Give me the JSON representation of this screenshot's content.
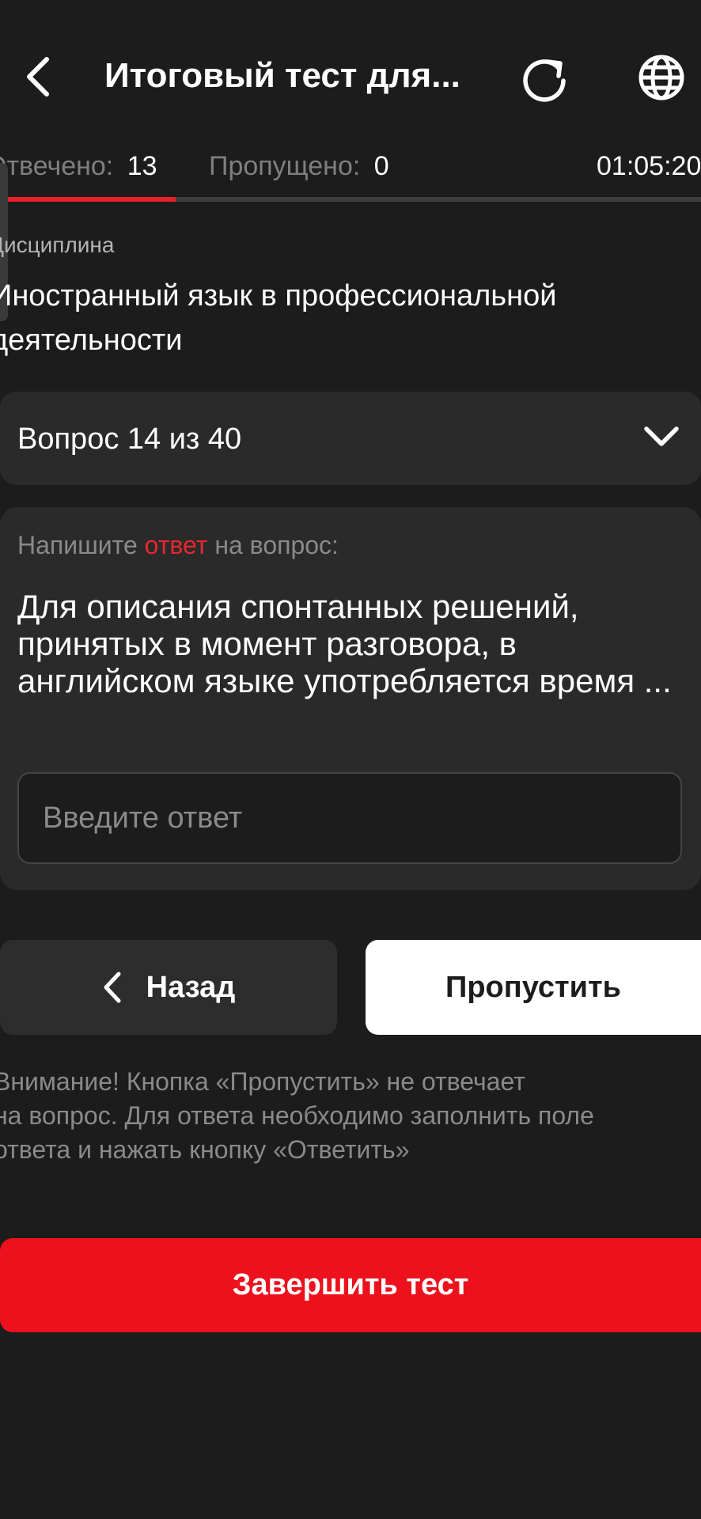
{
  "header": {
    "title": "Итоговый тест для...",
    "back_icon": "chevron-left-icon",
    "refresh_icon": "refresh-icon",
    "language_icon": "globe-icon"
  },
  "status": {
    "answered_label": "Отвечено:",
    "answered_count": "13",
    "skipped_label": "Пропущено:",
    "skipped_count": "0",
    "timer": "01:05:20",
    "progress_fraction": 0.25
  },
  "discipline": {
    "label": "Дисциплина",
    "name": "Иностранный язык в профессиональной деятельности"
  },
  "question_selector": {
    "label": "Вопрос 14 из 40",
    "icon": "chevron-down-icon"
  },
  "question": {
    "prompt_before": "Напишите ",
    "prompt_accent": "ответ",
    "prompt_after": " на вопрос:",
    "text": "Для описания спонтанных решений, принятых в момент разговора, в английском языке употребляется время ...",
    "answer_value": "",
    "answer_placeholder": "Введите ответ"
  },
  "actions": {
    "back_label": "Назад",
    "skip_label": "Пропустить",
    "finish_label": "Завершить тест"
  },
  "warning": {
    "lines": [
      "Внимание! Кнопка «Пропустить» не отвечает",
      "на вопрос. Для ответа необходимо заполнить поле",
      "ответа и нажать кнопку «Ответить»"
    ]
  },
  "colors": {
    "background": "#1c1c1c",
    "card": "#2a2a2a",
    "accent": "#e8262e",
    "finish": "#ec111c"
  }
}
